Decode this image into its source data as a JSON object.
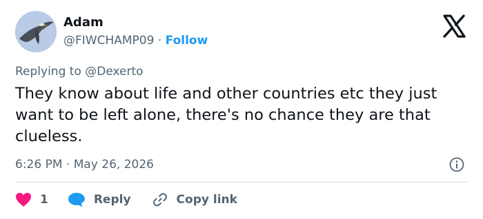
{
  "author": {
    "name": "Adam",
    "handle": "@FIWCHAMP09",
    "separator": "·",
    "follow_label": "Follow",
    "avatar_icon": "bird-of-prey-avatar"
  },
  "logo_icon": "x-logo-icon",
  "reply_context": {
    "prefix": "Replying to",
    "mention": "@Dexerto"
  },
  "tweet": {
    "text": "They know about life and other countries etc they just want to be left alone, there's no chance they are that clueless.",
    "timestamp": "6:26 PM · May 26, 2026"
  },
  "actions": {
    "like_count": "1",
    "reply_label": "Reply",
    "copy_link_label": "Copy link"
  },
  "colors": {
    "accent": "#1d9bf0",
    "like": "#f91880",
    "text": "#0f1419",
    "secondary": "#536471",
    "divider": "#cfd9de"
  }
}
